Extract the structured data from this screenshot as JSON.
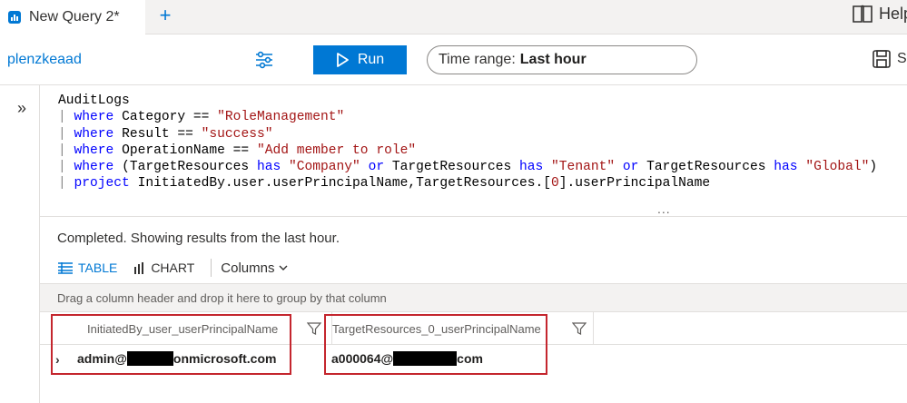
{
  "tabs": {
    "active_label": "New Query 2*",
    "add_label": "+"
  },
  "help": {
    "label": "Help"
  },
  "toolbar": {
    "workspace": "plenzkeaad",
    "run_label": "Run",
    "time_prefix": "Time range:",
    "time_value": "Last hour",
    "save_label": "S"
  },
  "rail": {
    "toggle": "»"
  },
  "editor": {
    "lines": [
      {
        "pipe": "",
        "tokens": [
          {
            "t": "AuditLogs",
            "c": "plain"
          }
        ]
      },
      {
        "pipe": "| ",
        "tokens": [
          {
            "t": "where",
            "c": "kw"
          },
          {
            "t": " Category == ",
            "c": "plain"
          },
          {
            "t": "\"RoleManagement\"",
            "c": "str"
          }
        ]
      },
      {
        "pipe": "| ",
        "tokens": [
          {
            "t": "where",
            "c": "kw"
          },
          {
            "t": " Result == ",
            "c": "plain"
          },
          {
            "t": "\"success\"",
            "c": "str"
          }
        ]
      },
      {
        "pipe": "| ",
        "tokens": [
          {
            "t": "where",
            "c": "kw"
          },
          {
            "t": " OperationName == ",
            "c": "plain"
          },
          {
            "t": "\"Add member to role\"",
            "c": "str"
          }
        ]
      },
      {
        "pipe": "| ",
        "tokens": [
          {
            "t": "where",
            "c": "kw"
          },
          {
            "t": " (TargetResources ",
            "c": "plain"
          },
          {
            "t": "has",
            "c": "kw"
          },
          {
            "t": " ",
            "c": "plain"
          },
          {
            "t": "\"Company\"",
            "c": "str"
          },
          {
            "t": " ",
            "c": "plain"
          },
          {
            "t": "or",
            "c": "kw"
          },
          {
            "t": " TargetResources ",
            "c": "plain"
          },
          {
            "t": "has",
            "c": "kw"
          },
          {
            "t": " ",
            "c": "plain"
          },
          {
            "t": "\"Tenant\"",
            "c": "str"
          },
          {
            "t": " ",
            "c": "plain"
          },
          {
            "t": "or",
            "c": "kw"
          },
          {
            "t": " TargetResources ",
            "c": "plain"
          },
          {
            "t": "has",
            "c": "kw"
          },
          {
            "t": " ",
            "c": "plain"
          },
          {
            "t": "\"Global\"",
            "c": "str"
          },
          {
            "t": ")",
            "c": "plain"
          }
        ]
      },
      {
        "pipe": "| ",
        "tokens": [
          {
            "t": "project",
            "c": "kw"
          },
          {
            "t": " InitiatedBy.user.userPrincipalName,TargetResources.[",
            "c": "plain"
          },
          {
            "t": "0",
            "c": "str"
          },
          {
            "t": "].userPrincipalName",
            "c": "plain"
          }
        ]
      }
    ],
    "more": "..."
  },
  "results": {
    "status": "Completed. Showing results from the last hour.",
    "tab_table": "TABLE",
    "tab_chart": "CHART",
    "columns_label": "Columns",
    "group_hint": "Drag a column header and drop it here to group by that column",
    "columns": [
      "InitiatedBy_user_userPrincipalName",
      "TargetResources_0_userPrincipalName"
    ],
    "rows": [
      {
        "expand": "›",
        "col1_prefix": "admin@",
        "col1_suffix": "onmicrosoft.com",
        "col2_prefix": "a000064@",
        "col2_suffix": "com"
      }
    ]
  },
  "colors": {
    "accent": "#0078d4",
    "highlight_border": "#c4262e",
    "keyword": "#0000ff",
    "string": "#a31515"
  }
}
